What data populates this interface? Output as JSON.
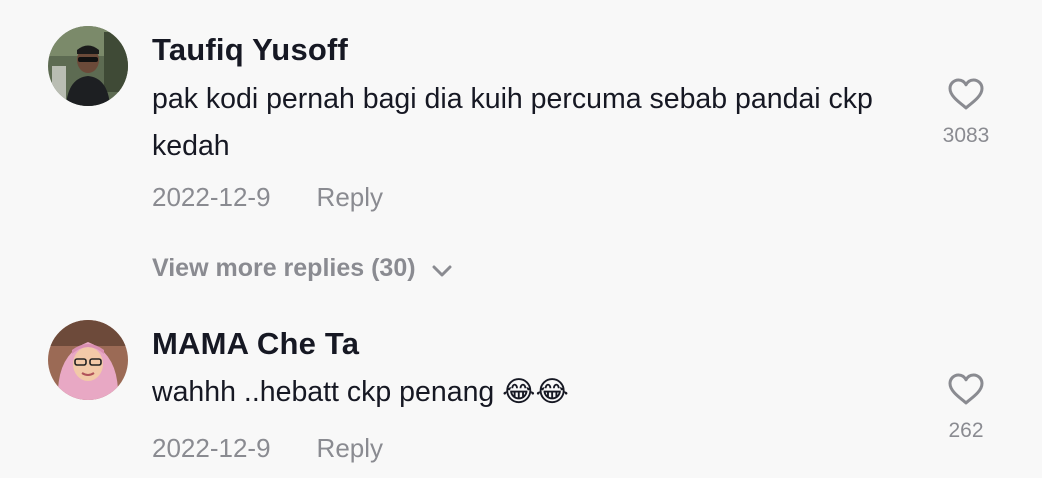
{
  "comments": [
    {
      "username": "Taufiq Yusoff",
      "text": "pak kodi pernah bagi dia kuih percuma sebab pandai ckp kedah",
      "date": "2022-12-9",
      "reply_label": "Reply",
      "likes": "3083",
      "avatar_icon": "user-avatar-man-sunglasses"
    },
    {
      "username": "MAMA Che Ta",
      "text": "wahhh ..hebatt ckp penang 😂😂",
      "date": "2022-12-9",
      "reply_label": "Reply",
      "likes": "262",
      "avatar_icon": "user-avatar-woman-hijab"
    }
  ],
  "view_more": {
    "label": "View more replies (30)"
  },
  "colors": {
    "background": "#f8f8f8",
    "text": "#161823",
    "muted": "#8a8b91"
  }
}
